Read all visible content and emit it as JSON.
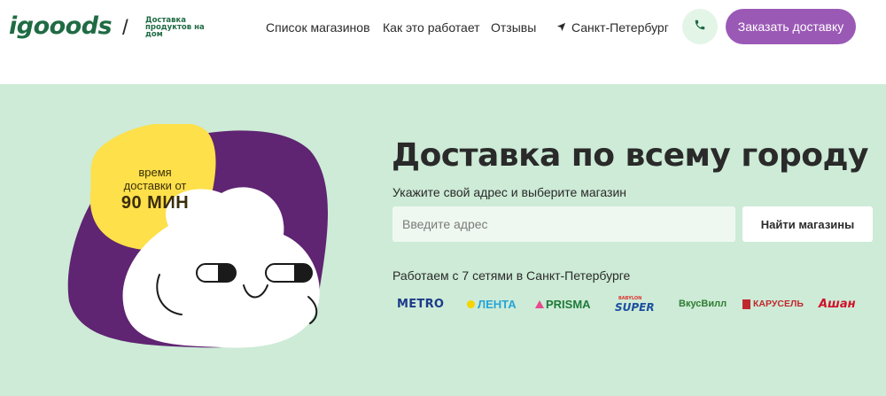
{
  "header": {
    "logo": "igooods",
    "slash": "/",
    "tagline": "Доставка продуктов на дом",
    "nav": [
      "Список магазинов",
      "Как это работает",
      "Отзывы"
    ],
    "city": "Санкт-Петербург",
    "order_button": "Заказать доставку"
  },
  "hero": {
    "badge": {
      "line1": "время",
      "line2": "доставки от",
      "line3": "90 МИН"
    },
    "title": "Доставка по всему городу",
    "subtitle": "Укажите свой адрес и выберите магазин",
    "address_placeholder": "Введите адрес",
    "address_value": "",
    "find_button": "Найти магазины",
    "networks_text": "Работаем с 7 сетями в Санкт-Петербурге",
    "stores": [
      "METRO",
      "ЛЕНТА",
      "PRISMA",
      "SUPER",
      "ВкусВилл",
      "КАРУСЕЛЬ",
      "Ашан"
    ],
    "store_super_small": "BABYLON"
  },
  "colors": {
    "brand_green": "#1f6b43",
    "hero_bg": "#cdebd6",
    "purple": "#9b59b6",
    "blob_purple": "#5f2472",
    "badge_yellow": "#fde04a"
  }
}
